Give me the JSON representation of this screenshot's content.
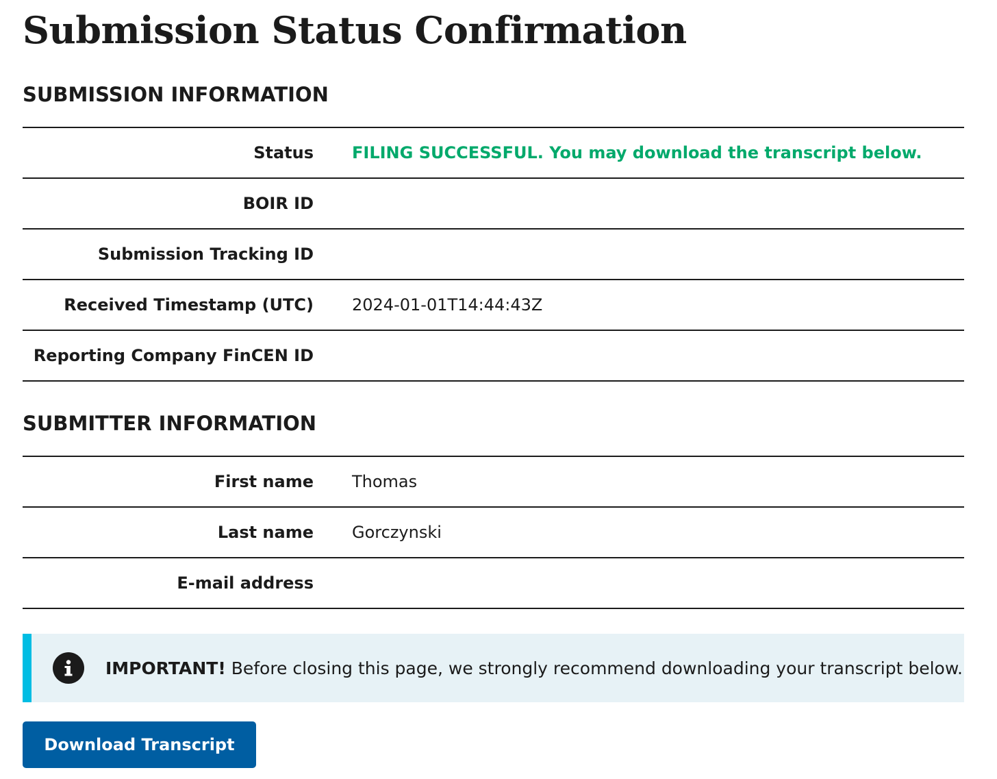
{
  "page": {
    "title": "Submission Status Confirmation"
  },
  "submission": {
    "heading": "SUBMISSION INFORMATION",
    "rows": [
      {
        "label": "Status",
        "value": "FILING SUCCESSFUL. You may download the transcript below.",
        "status": "success"
      },
      {
        "label": "BOIR ID",
        "value": ""
      },
      {
        "label": "Submission Tracking ID",
        "value": ""
      },
      {
        "label": "Received Timestamp (UTC)",
        "value": "2024-01-01T14:44:43Z"
      },
      {
        "label": "Reporting Company FinCEN ID",
        "value": ""
      }
    ]
  },
  "submitter": {
    "heading": "SUBMITTER INFORMATION",
    "rows": [
      {
        "label": "First name",
        "value": "Thomas"
      },
      {
        "label": "Last name",
        "value": "Gorczynski"
      },
      {
        "label": "E-mail address",
        "value": ""
      }
    ]
  },
  "alert": {
    "icon": "info-icon",
    "strong": "IMPORTANT!",
    "message": "Before closing this page, we strongly recommend downloading your transcript below."
  },
  "actions": {
    "download_label": "Download Transcript"
  },
  "colors": {
    "success": "#00a96b",
    "alert_border": "#00bde3",
    "alert_background": "#e7f2f6",
    "primary_button": "#005ea2"
  }
}
